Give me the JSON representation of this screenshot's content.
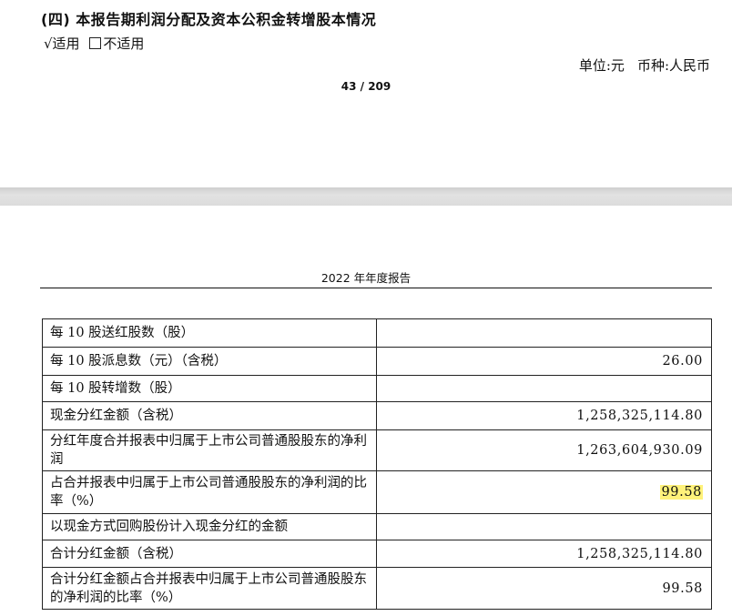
{
  "section": {
    "title": "(四) 本报告期利润分配及资本公积金转增股本情况",
    "applicable_label": "√适用",
    "not_applicable_label": "不适用"
  },
  "unit_line": {
    "unit": "单位:元",
    "currency": "币种:人民币"
  },
  "page_number": "43 / 209",
  "report_header": "2022 年年度报告",
  "table": {
    "rows": [
      {
        "label": "每 10 股送红股数（股）",
        "value": ""
      },
      {
        "label": "每 10 股派息数（元）（含税）",
        "value": "26.00"
      },
      {
        "label": "每 10 股转增数（股）",
        "value": ""
      },
      {
        "label": "现金分红金额（含税）",
        "value": "1,258,325,114.80"
      },
      {
        "label": "分红年度合并报表中归属于上市公司普通股股东的净利润",
        "value": "1,263,604,930.09"
      },
      {
        "label": "占合并报表中归属于上市公司普通股股东的净利润的比率（%）",
        "value": "99.58"
      },
      {
        "label": "以现金方式回购股份计入现金分红的金额",
        "value": ""
      },
      {
        "label": "合计分红金额（含税）",
        "value": "1,258,325,114.80"
      },
      {
        "label": "合计分红金额占合并报表中归属于上市公司普通股股东的净利润的比率（%）",
        "value": "99.58"
      }
    ]
  },
  "highlight_color": "#fff27a"
}
